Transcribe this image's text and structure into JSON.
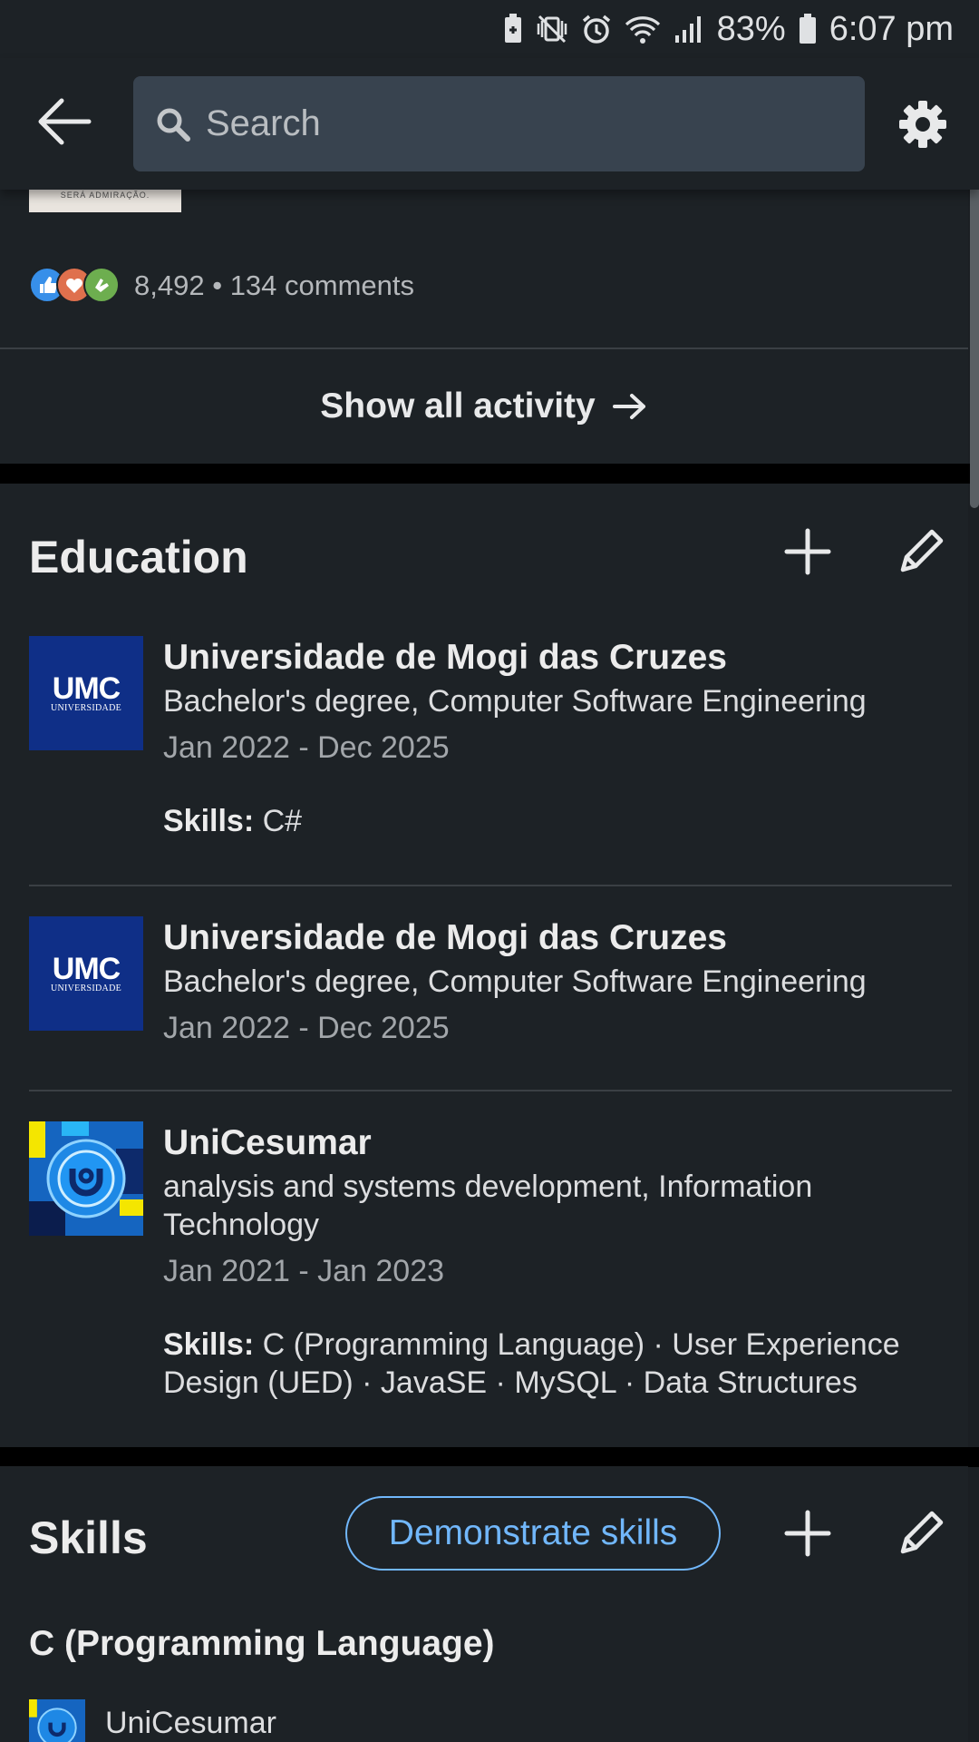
{
  "status_bar": {
    "battery_percent": "83%",
    "time": "6:07 pm",
    "icons": [
      "battery-saver-icon",
      "vibrate-mute-icon",
      "alarm-icon",
      "wifi-icon",
      "signal-icon",
      "battery-icon"
    ]
  },
  "top_bar": {
    "search_placeholder": "Search",
    "icons": [
      "back-arrow-icon",
      "search-icon",
      "gear-icon"
    ]
  },
  "activity": {
    "post_thumb_text": "SERÁ ADMIRAÇÃO.",
    "reaction_count": "8,492",
    "comments": "134 comments",
    "separator": "•",
    "show_all_label": "Show all activity",
    "reaction_icons": [
      "like-icon",
      "love-icon",
      "support-icon"
    ]
  },
  "education": {
    "title": "Education",
    "items": [
      {
        "school": "Universidade de Mogi das Cruzes",
        "degree": "Bachelor's degree, Computer Software Engineering",
        "dates": "Jan 2022 - Dec 2025",
        "skills_label": "Skills:",
        "skills": "C#",
        "logo_text": "UMC",
        "logo_subtext": "UNIVERSIDADE"
      },
      {
        "school": "Universidade de Mogi das Cruzes",
        "degree": "Bachelor's degree, Computer Software Engineering",
        "dates": "Jan 2022 - Dec 2025",
        "logo_text": "UMC",
        "logo_subtext": "UNIVERSIDADE"
      },
      {
        "school": "UniCesumar",
        "degree": "analysis and systems development, Information Technology",
        "dates": "Jan 2021 - Jan 2023",
        "skills_label": "Skills:",
        "skills": "C (Programming Language) · User Experience Design (UED) · JavaSE · MySQL · Data Structures"
      }
    ]
  },
  "skills": {
    "title": "Skills",
    "demonstrate_label": "Demonstrate skills",
    "first_skill": "C (Programming Language)",
    "first_skill_source": "UniCesumar"
  },
  "colors": {
    "background": "#1b1f23",
    "card": "#1d2226",
    "accent_blue": "#71b7fb",
    "umc_blue": "#0f2f87"
  }
}
